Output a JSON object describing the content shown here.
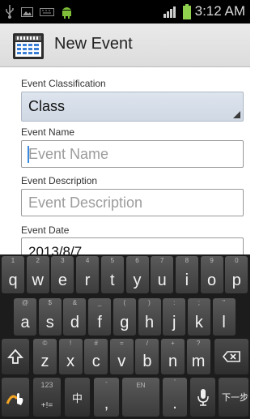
{
  "status_bar": {
    "time": "3:12 AM",
    "icons": [
      "usb-icon",
      "image-icon",
      "keyboard-icon",
      "android-icon",
      "signal-icon",
      "battery-icon"
    ]
  },
  "action_bar": {
    "title": "New Event",
    "icon": "calendar-icon"
  },
  "form": {
    "classification_label": "Event Classification",
    "classification_value": "Class",
    "name_label": "Event Name",
    "name_placeholder": "Event Name",
    "description_label": "Event Description",
    "description_placeholder": "Event Description",
    "date_label": "Event Date",
    "date_value": "2013/8/7"
  },
  "keyboard": {
    "row1": [
      {
        "hint": "1",
        "main": "q"
      },
      {
        "hint": "2",
        "main": "w"
      },
      {
        "hint": "3",
        "main": "e"
      },
      {
        "hint": "4",
        "main": "r"
      },
      {
        "hint": "5",
        "main": "t"
      },
      {
        "hint": "6",
        "main": "y"
      },
      {
        "hint": "7",
        "main": "u"
      },
      {
        "hint": "8",
        "main": "i"
      },
      {
        "hint": "9",
        "main": "o"
      },
      {
        "hint": "0",
        "main": "p"
      }
    ],
    "row2": [
      {
        "hint": "@",
        "main": "a"
      },
      {
        "hint": "$",
        "main": "s"
      },
      {
        "hint": "&",
        "main": "d"
      },
      {
        "hint": "_",
        "main": "f"
      },
      {
        "hint": "(",
        "main": "g"
      },
      {
        "hint": ")",
        "main": "h"
      },
      {
        "hint": ":",
        "main": "j"
      },
      {
        "hint": ";",
        "main": "k"
      },
      {
        "hint": "\"",
        "main": "l"
      }
    ],
    "row3": [
      {
        "hint": "©",
        "main": "z"
      },
      {
        "hint": "!",
        "main": "x"
      },
      {
        "hint": "#",
        "main": "c"
      },
      {
        "hint": "=",
        "main": "v"
      },
      {
        "hint": "/",
        "main": "b"
      },
      {
        "hint": "+",
        "main": "n"
      },
      {
        "hint": "?",
        "main": "m"
      }
    ],
    "sym_top": "123",
    "sym_bottom": "+!=",
    "lang_key": "中",
    "comma_hint": "-",
    "comma": ",",
    "space_label": "EN",
    "period_hint": "'",
    "period": ".",
    "next_label": "下一步",
    "icons": [
      "shift-icon",
      "backspace-icon",
      "swype-icon",
      "microphone-icon"
    ]
  }
}
